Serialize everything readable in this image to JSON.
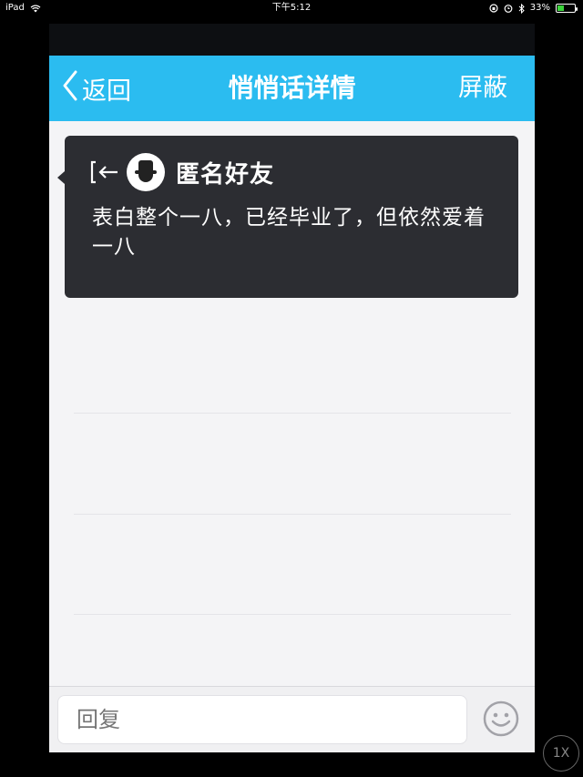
{
  "status_bar": {
    "device": "iPad",
    "time": "下午5:12",
    "battery": "33%",
    "battery_level": 0.33
  },
  "nav": {
    "back_label": "返回",
    "title": "悄悄话详情",
    "right_label": "屏蔽"
  },
  "message": {
    "sender": "匿名好友",
    "text": "表白整个一八，已经毕业了，但依然爱着一八"
  },
  "reply": {
    "placeholder": "回复"
  },
  "zoom": {
    "label": "1X"
  },
  "colors": {
    "navbar": "#2bbcf0",
    "bubble": "#2c2d32",
    "background": "#f4f4f6"
  }
}
